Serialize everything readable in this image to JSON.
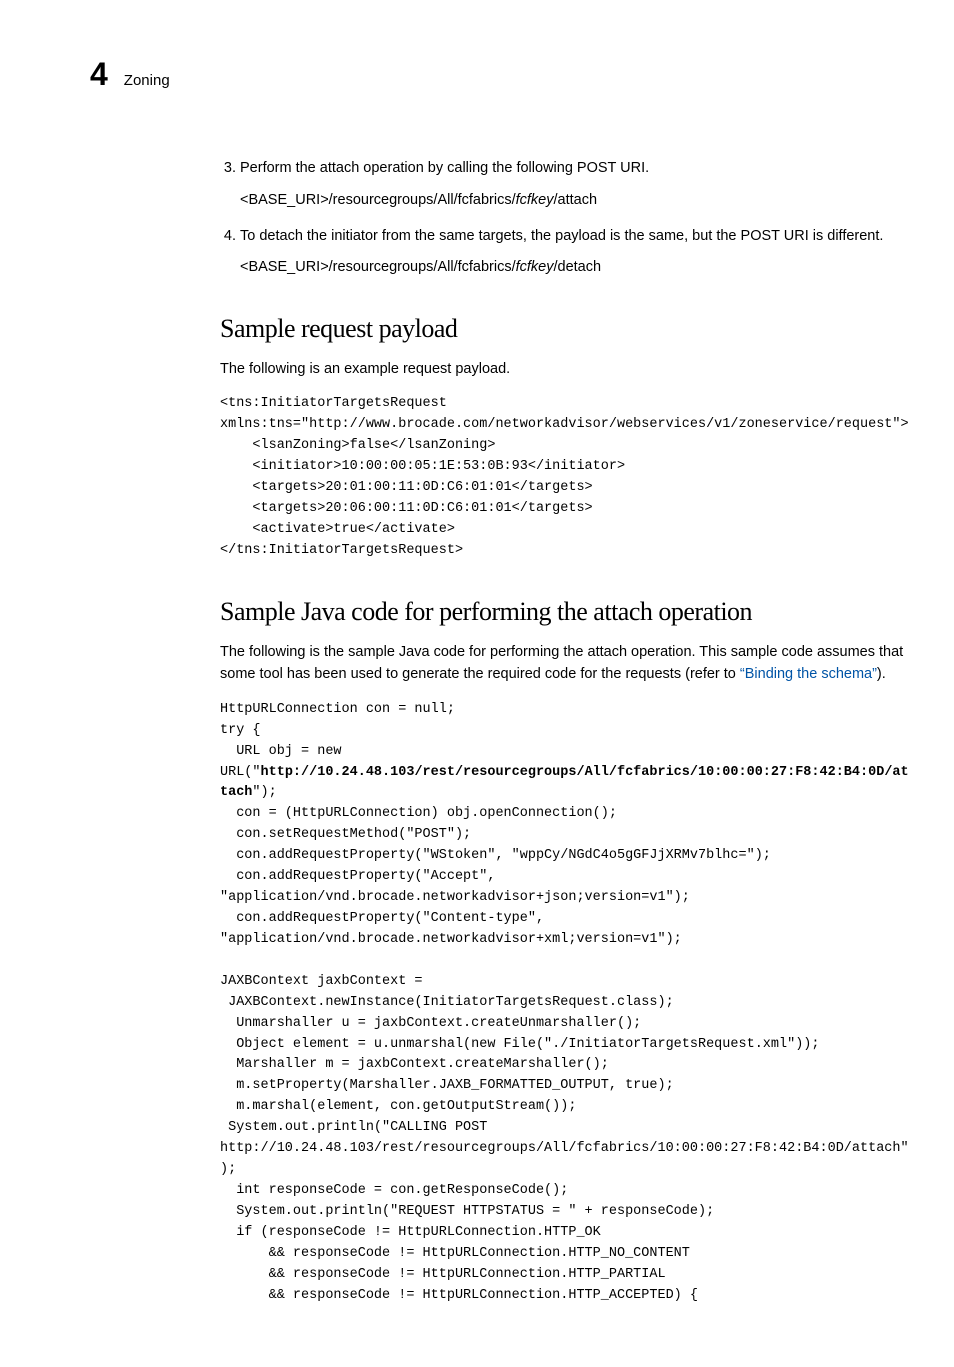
{
  "header": {
    "chapter_number": "4",
    "chapter_title": "Zoning"
  },
  "steps": {
    "start": 3,
    "items": [
      {
        "text": "Perform the attach operation by calling the following POST URI.",
        "sub_pre": "<BASE_URI>/resourcegroups/All/fcfabrics/",
        "sub_em": "fcfkey",
        "sub_post": "/attach"
      },
      {
        "text": "To detach the initiator from the same targets, the payload is the same, but the POST URI is different.",
        "sub_pre": "<BASE_URI>/resourcegroups/All/fcfabrics/",
        "sub_em": "fcfkey",
        "sub_post": "/detach"
      }
    ]
  },
  "sample_payload": {
    "heading": "Sample request payload",
    "intro": "The following is an example request payload.",
    "code": "<tns:InitiatorTargetsRequest\nxmlns:tns=\"http://www.brocade.com/networkadvisor/webservices/v1/zoneservice/request\">\n    <lsanZoning>false</lsanZoning>\n    <initiator>10:00:00:05:1E:53:0B:93</initiator>\n    <targets>20:01:00:11:0D:C6:01:01</targets>\n    <targets>20:06:00:11:0D:C6:01:01</targets>\n    <activate>true</activate>\n</tns:InitiatorTargetsRequest>"
  },
  "sample_java": {
    "heading": "Sample Java code for performing the attach operation",
    "intro_pre": "The following is the sample Java code for performing the attach operation. This sample code assumes that some tool has been used to generate the required code for the requests (refer to ",
    "intro_link": "“Binding the schema”",
    "intro_post": ").",
    "code_1": "HttpURLConnection con = null;\ntry {\n  URL obj = new\nURL(\"",
    "code_bold": "http://10.24.48.103/rest/resourcegroups/All/fcfabrics/10:00:00:27:F8:42:B4:0D/attach",
    "code_2": "\");\n  con = (HttpURLConnection) obj.openConnection();\n  con.setRequestMethod(\"POST\");\n  con.addRequestProperty(\"WStoken\", \"wppCy/NGdC4o5gGFJjXRMv7blhc=\");\n  con.addRequestProperty(\"Accept\",\n\"application/vnd.brocade.networkadvisor+json;version=v1\");\n  con.addRequestProperty(\"Content-type\",\n\"application/vnd.brocade.networkadvisor+xml;version=v1\");\n\nJAXBContext jaxbContext =\n JAXBContext.newInstance(InitiatorTargetsRequest.class);\n  Unmarshaller u = jaxbContext.createUnmarshaller();\n  Object element = u.unmarshal(new File(\"./InitiatorTargetsRequest.xml\"));\n  Marshaller m = jaxbContext.createMarshaller();\n  m.setProperty(Marshaller.JAXB_FORMATTED_OUTPUT, true);\n  m.marshal(element, con.getOutputStream());\n System.out.println(\"CALLING POST\nhttp://10.24.48.103/rest/resourcegroups/All/fcfabrics/10:00:00:27:F8:42:B4:0D/attach\");\n  int responseCode = con.getResponseCode();\n  System.out.println(\"REQUEST HTTPSTATUS = \" + responseCode);\n  if (responseCode != HttpURLConnection.HTTP_OK\n      && responseCode != HttpURLConnection.HTTP_NO_CONTENT\n      && responseCode != HttpURLConnection.HTTP_PARTIAL\n      && responseCode != HttpURLConnection.HTTP_ACCEPTED) {"
  }
}
